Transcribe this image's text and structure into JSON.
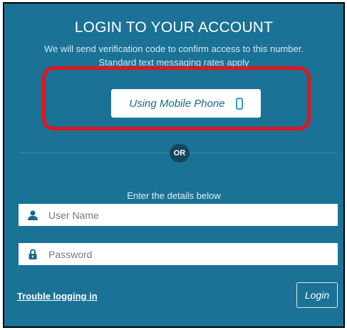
{
  "login": {
    "title": "LOGIN TO YOUR ACCOUNT",
    "subtitle_line1": "We will send verification code to confirm access to this number.",
    "subtitle_line2": "Standard text messaging rates apply",
    "mobile_button_label": "Using Mobile Phone",
    "or_label": "OR",
    "details_label": "Enter the details below",
    "username_placeholder": "User Name",
    "password_placeholder": "Password",
    "trouble_link": "Trouble logging in",
    "login_button": "Login"
  },
  "colors": {
    "panel_bg": "#1a7296",
    "highlight_border": "#e3151d",
    "or_badge_bg": "#11475f",
    "icon_color": "#1b6a8b"
  },
  "icons": {
    "phone": "mobile-phone-icon",
    "user": "user-icon",
    "password": "lock-icon"
  }
}
